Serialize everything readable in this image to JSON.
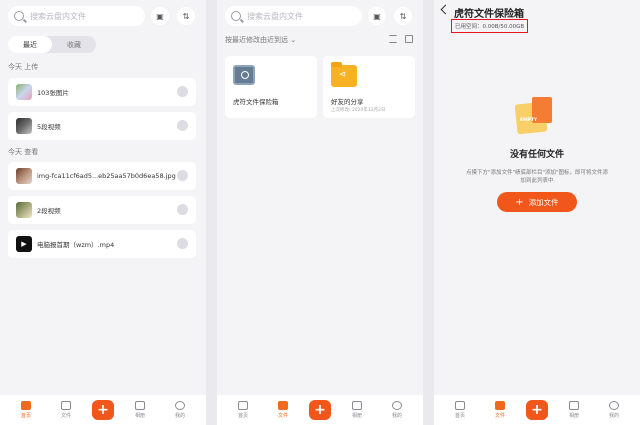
{
  "panel1": {
    "search_placeholder": "搜索云盘内文件",
    "seg_recent": "最近",
    "seg_fav": "收藏",
    "section_upload": "今天 上传",
    "section_view": "今天 查看",
    "items": [
      {
        "name": "103张图片"
      },
      {
        "name": "5段视频"
      },
      {
        "name": "img-fca11cf6ad5...eb25aa57b0d6ea58.jpg"
      },
      {
        "name": "2段视频"
      },
      {
        "name": "电脑报首期（wzm）.mp4"
      }
    ]
  },
  "panel2": {
    "search_placeholder": "搜索云盘内文件",
    "sort_label": "按最近修改由近到远 ⌄",
    "card1": {
      "name": "虎符文件保险箱"
    },
    "card2": {
      "name": "好友的分享",
      "sub": "上次修改: 2020年12月2日"
    }
  },
  "panel3": {
    "title": "虎符文件保险箱",
    "usage": "已用空间：0.00B/50.00GB",
    "empty_art_text": "EMPTY",
    "empty_title": "没有任何文件",
    "hint": "点摸下方\"添加文件\"绩底部栏目\"添加\"图标，即可将文件添加到此列表中",
    "add_label": "添加文件"
  },
  "tabs": [
    "首页",
    "文件",
    "相册",
    "我的"
  ],
  "colors": {
    "accent": "#f1571b",
    "background": "#f4f4f7",
    "highlight": "#e8141f"
  }
}
